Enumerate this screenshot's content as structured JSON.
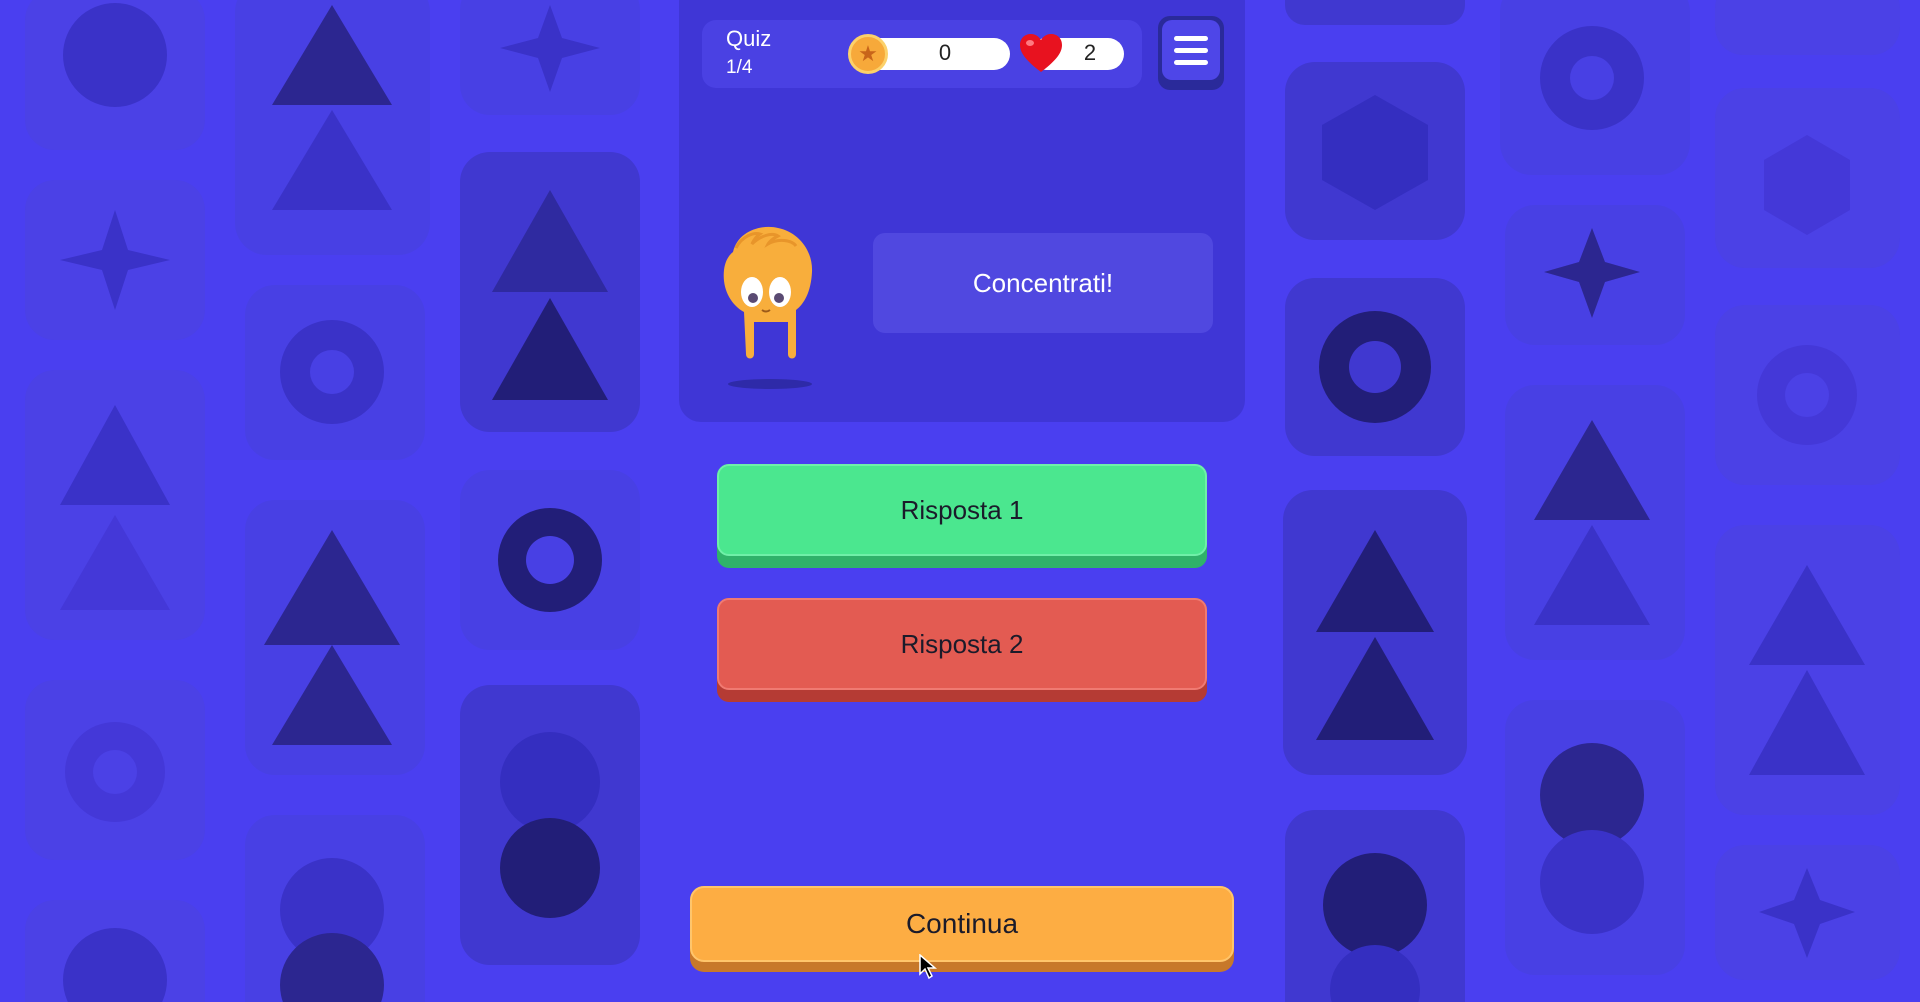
{
  "header": {
    "title": "Quiz",
    "progress": "1/4",
    "coins": "0",
    "lives": "2"
  },
  "icons": {
    "coin": "star-coin-icon",
    "lives": "heart-icon",
    "menu": "hamburger-menu-icon"
  },
  "mascot": {
    "speech": "Concentrati!"
  },
  "answers": [
    {
      "label": "Risposta 1",
      "state": "correct"
    },
    {
      "label": "Risposta 2",
      "state": "wrong"
    }
  ],
  "continue_label": "Continua",
  "colors": {
    "background": "#4a3ff0",
    "panel": "#3f36d6",
    "correct": "#4be78f",
    "wrong": "#e35b52",
    "continue": "#fdad43",
    "mascot": "#f8ae3c"
  }
}
